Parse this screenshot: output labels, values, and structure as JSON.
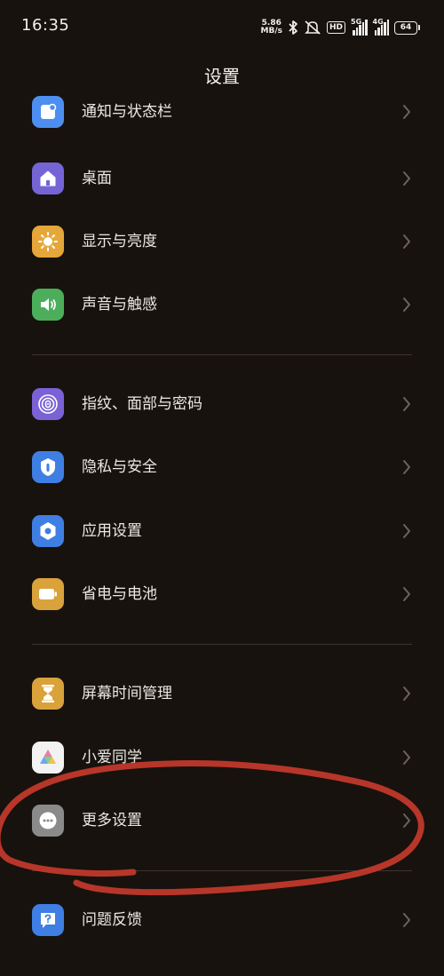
{
  "status_bar": {
    "time": "16:35",
    "net_speed_value": "5.86",
    "net_speed_unit": "MB/s",
    "hd_label": "HD",
    "signal_1_type": "5G",
    "signal_2_type": "4G",
    "battery_level": "64",
    "icons": [
      "bluetooth-icon",
      "mute-icon",
      "hd-icon",
      "signal-5g-icon",
      "signal-4g-icon",
      "battery-icon"
    ]
  },
  "header": {
    "title": "设置"
  },
  "settings": {
    "items": [
      {
        "label": "通知与状态栏",
        "icon": "notification-icon",
        "color": "#4d8ff0"
      },
      {
        "label": "桌面",
        "icon": "home-icon",
        "color": "#7564d6"
      },
      {
        "label": "显示与亮度",
        "icon": "sun-icon",
        "color": "#e5a73a"
      },
      {
        "label": "声音与触感",
        "icon": "speaker-icon",
        "color": "#4cae5a"
      },
      {
        "label": "指纹、面部与密码",
        "icon": "fingerprint-icon",
        "color": "#7a62d6"
      },
      {
        "label": "隐私与安全",
        "icon": "privacy-shield-icon",
        "color": "#3f7ee3"
      },
      {
        "label": "应用设置",
        "icon": "app-settings-icon",
        "color": "#3f7ee3"
      },
      {
        "label": "省电与电池",
        "icon": "battery-saver-icon",
        "color": "#d9a23a"
      },
      {
        "label": "屏幕时间管理",
        "icon": "hourglass-icon",
        "color": "#d9a23a"
      },
      {
        "label": "小爱同学",
        "icon": "xiaoai-icon",
        "color": "#f2f2f2"
      },
      {
        "label": "更多设置",
        "icon": "more-icon",
        "color": "#8a8a8a"
      },
      {
        "label": "问题反馈",
        "icon": "feedback-icon",
        "color": "#3f7ee3"
      }
    ]
  },
  "colors": {
    "background": "#17120d",
    "divider": "#3a342d",
    "annotation": "#c0392b"
  }
}
